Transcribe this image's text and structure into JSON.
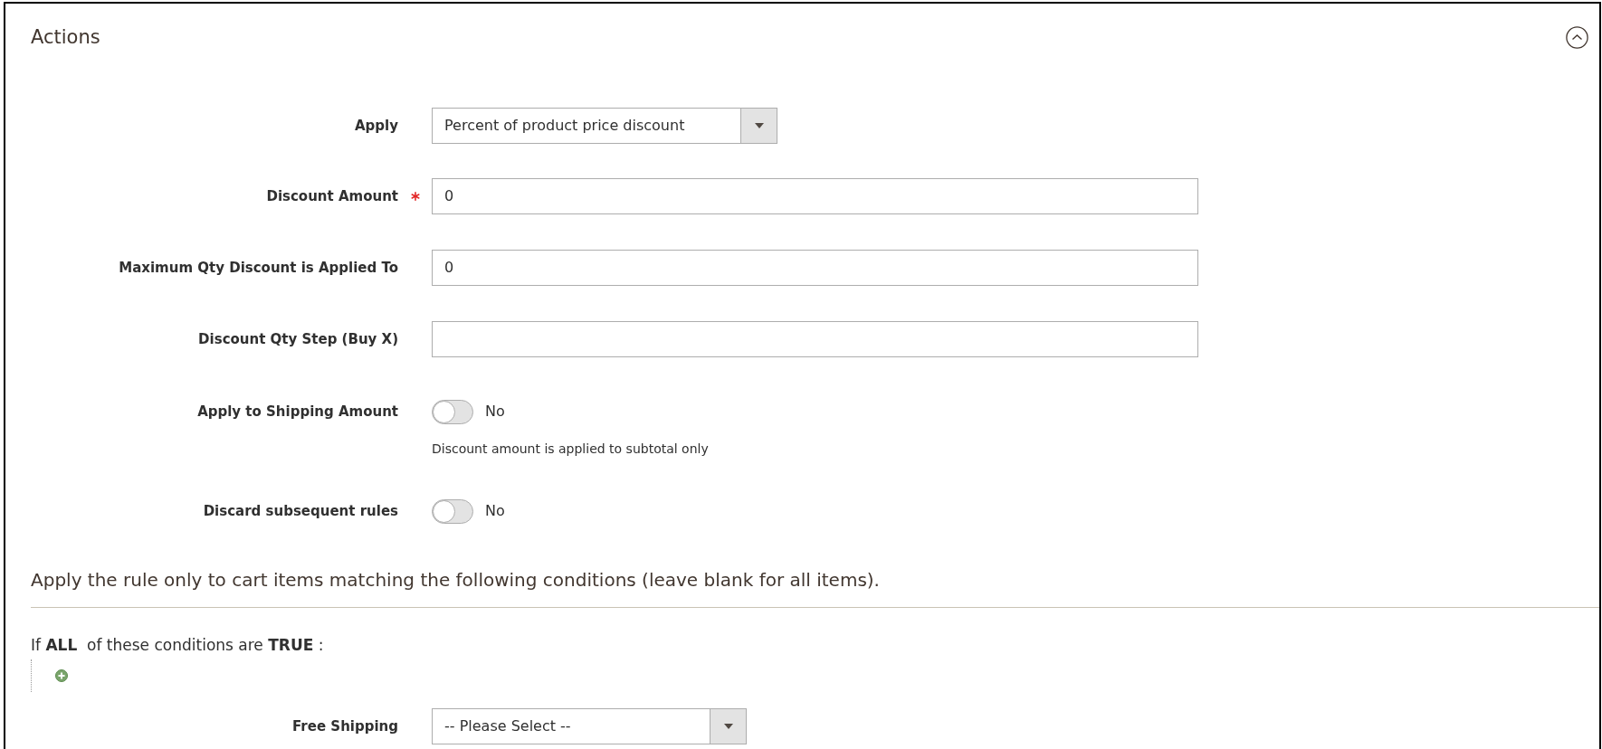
{
  "section": {
    "title": "Actions",
    "expanded": true
  },
  "fields": [
    {
      "kind": "select",
      "label": "Apply",
      "value": "Percent of product price discount",
      "required": false
    },
    {
      "kind": "input",
      "label": "Discount Amount",
      "value": "0",
      "required": true
    },
    {
      "kind": "input",
      "label": "Maximum Qty Discount is Applied To",
      "value": "0",
      "required": false
    },
    {
      "kind": "input",
      "label": "Discount Qty Step (Buy X)",
      "required": false
    },
    {
      "kind": "toggle",
      "label": "Apply to Shipping Amount",
      "on": false,
      "state_text": "No",
      "note": "Discount amount is applied to subtotal only",
      "required": false
    },
    {
      "kind": "toggle",
      "label": "Discard subsequent rules",
      "on": false,
      "state_text": "No",
      "required": false
    }
  ],
  "conditions": {
    "heading": "Apply the rule only to cart items matching the following conditions (leave blank for all items).",
    "summary": "If **ALL**  of these conditions are **TRUE** :"
  },
  "free_shipping": {
    "kind": "select",
    "label": "Free Shipping",
    "value": "-- Please Select --"
  }
}
